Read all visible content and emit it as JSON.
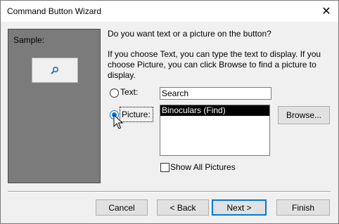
{
  "window": {
    "title": "Command Button Wizard",
    "close_icon": "close-icon"
  },
  "sample": {
    "label": "Sample:",
    "button_icon": "binoculars-icon"
  },
  "question": {
    "line1": "Do you want text or a picture on the button?",
    "line2": "If you choose Text, you can type the text to display.  If you choose Picture, you can click Browse to find a picture to display."
  },
  "options": {
    "text_label": "Text:",
    "text_value": "Search",
    "picture_label": "Picture:",
    "selected": "picture",
    "picture_list": [
      {
        "label": "Binoculars (Find)",
        "selected": true
      }
    ],
    "browse_label": "Browse...",
    "show_all_label": "Show All Pictures",
    "show_all_checked": false
  },
  "footer": {
    "cancel": "Cancel",
    "back": "< Back",
    "next": "Next >",
    "finish": "Finish"
  },
  "colors": {
    "accent": "#0078d7",
    "sample_bg": "#7b7b7b"
  }
}
